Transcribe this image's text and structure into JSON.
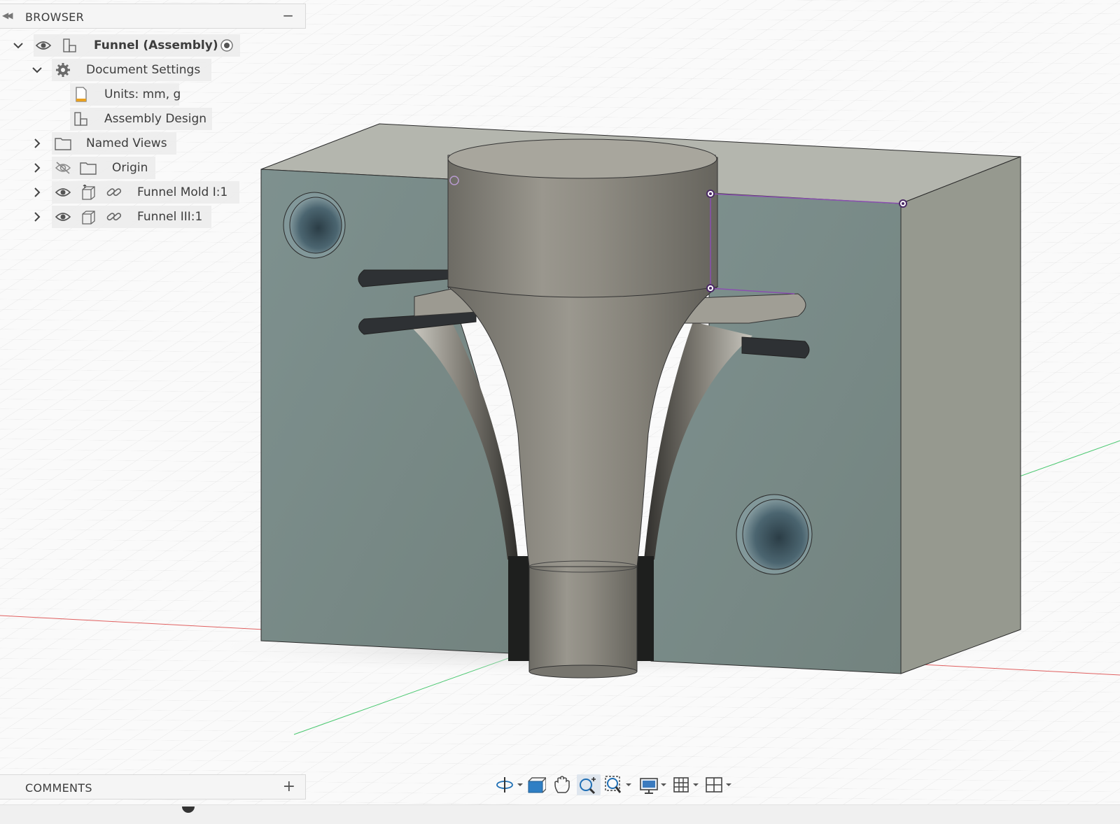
{
  "browser": {
    "title": "BROWSER",
    "root": {
      "label": "Funnel (Assembly)"
    },
    "items": [
      {
        "label": "Document Settings"
      },
      {
        "label": "Units: mm, g"
      },
      {
        "label": "Assembly Design"
      },
      {
        "label": "Named Views"
      },
      {
        "label": "Origin"
      },
      {
        "label": "Funnel Mold I:1"
      },
      {
        "label": "Funnel III:1"
      }
    ]
  },
  "comments": {
    "title": "COMMENTS"
  },
  "icons": {
    "browser_collapse": "double-chevron-left-icon",
    "minimize": "minus-icon",
    "expand": "chevron-icon",
    "visibility": "eye-icon",
    "hidden": "eye-slash-icon",
    "settings": "gear-icon",
    "units": "document-icon",
    "assembly": "assembly-icon",
    "folder": "folder-icon",
    "link": "link-icon",
    "component": "component-icon",
    "activate": "radio-icon",
    "add": "plus-icon"
  },
  "nav_toolbar": [
    "orbit-icon",
    "look-at-icon",
    "pan-icon",
    "zoom-icon",
    "fit-icon",
    "display-settings-icon",
    "grid-icon",
    "viewports-icon"
  ],
  "colors": {
    "mold_face": "#7b8f8d",
    "mold_side": "#95988f",
    "mold_top": "#b6b8b0",
    "funnel": "#8f8c83",
    "selection": "#8a4fb0",
    "x_axis": "#e06060",
    "y_axis": "#4ac870"
  }
}
